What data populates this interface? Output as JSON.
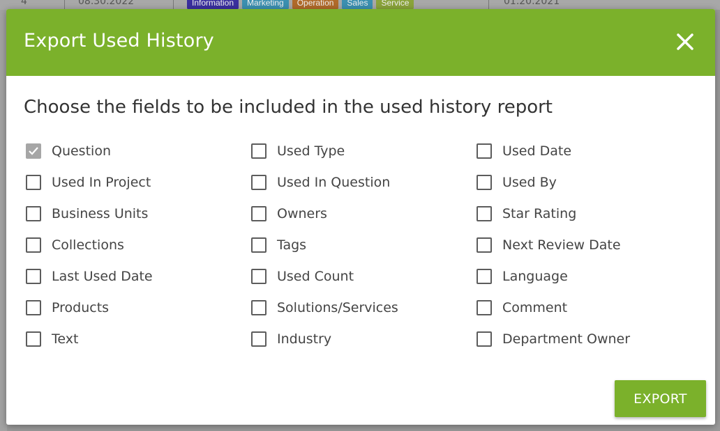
{
  "background": {
    "count": "4",
    "date_left": "08.30.2022",
    "date_right": "01.20.2021",
    "tags": [
      {
        "label": "Information",
        "color": "#3a2f9e"
      },
      {
        "label": "Marketing",
        "color": "#3b8fb0"
      },
      {
        "label": "Operation",
        "color": "#b06a2a"
      },
      {
        "label": "Sales",
        "color": "#3b8fb0"
      },
      {
        "label": "Service",
        "color": "#8aa33a"
      }
    ]
  },
  "modal": {
    "title": "Export Used History",
    "instructions": "Choose the fields to be included in the used history report",
    "export_label": "EXPORT",
    "accent_color": "#7bb12b",
    "fields": [
      {
        "label": "Question",
        "checked": true
      },
      {
        "label": "Used Type",
        "checked": false
      },
      {
        "label": "Used Date",
        "checked": false
      },
      {
        "label": "Used In Project",
        "checked": false
      },
      {
        "label": "Used In Question",
        "checked": false
      },
      {
        "label": "Used By",
        "checked": false
      },
      {
        "label": "Business Units",
        "checked": false
      },
      {
        "label": "Owners",
        "checked": false
      },
      {
        "label": "Star Rating",
        "checked": false
      },
      {
        "label": "Collections",
        "checked": false
      },
      {
        "label": "Tags",
        "checked": false
      },
      {
        "label": "Next Review Date",
        "checked": false
      },
      {
        "label": "Last Used Date",
        "checked": false
      },
      {
        "label": "Used Count",
        "checked": false
      },
      {
        "label": "Language",
        "checked": false
      },
      {
        "label": "Products",
        "checked": false
      },
      {
        "label": "Solutions/Services",
        "checked": false
      },
      {
        "label": "Comment",
        "checked": false
      },
      {
        "label": "Text",
        "checked": false
      },
      {
        "label": "Industry",
        "checked": false
      },
      {
        "label": "Department Owner",
        "checked": false
      }
    ]
  }
}
